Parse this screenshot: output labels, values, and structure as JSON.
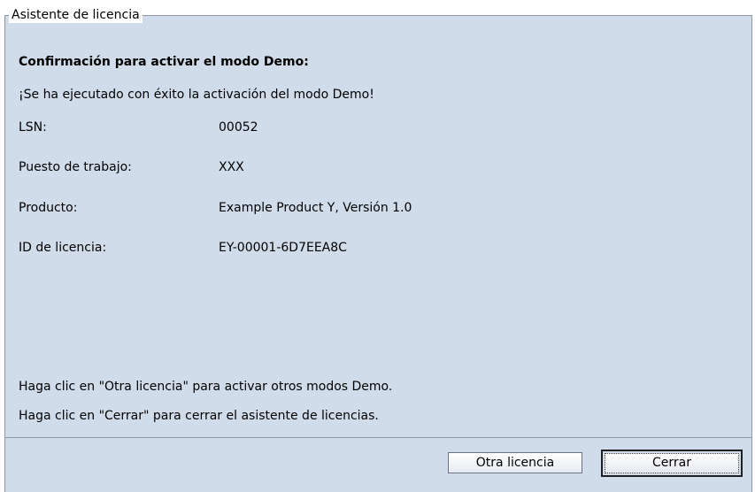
{
  "group": {
    "title": "Asistente de licencia"
  },
  "heading": "Confirmación para activar el modo Demo:",
  "success_message": "¡Se ha ejecutado con éxito la activación del modo Demo!",
  "fields": [
    {
      "label": "LSN:",
      "value": "00052"
    },
    {
      "label": "Puesto de trabajo:",
      "value": "XXX"
    },
    {
      "label": "Producto:",
      "value": "Example Product Y, Versión  1.0"
    },
    {
      "label": "ID de licencia:",
      "value": "EY-00001-6D7EEA8C"
    }
  ],
  "hints": [
    "Haga clic en \"Otra licencia\" para activar otros modos Demo.",
    "Haga clic en \"Cerrar\" para cerrar el asistente de licencias."
  ],
  "buttons": {
    "other_license": "Otra licencia",
    "close": "Cerrar"
  }
}
